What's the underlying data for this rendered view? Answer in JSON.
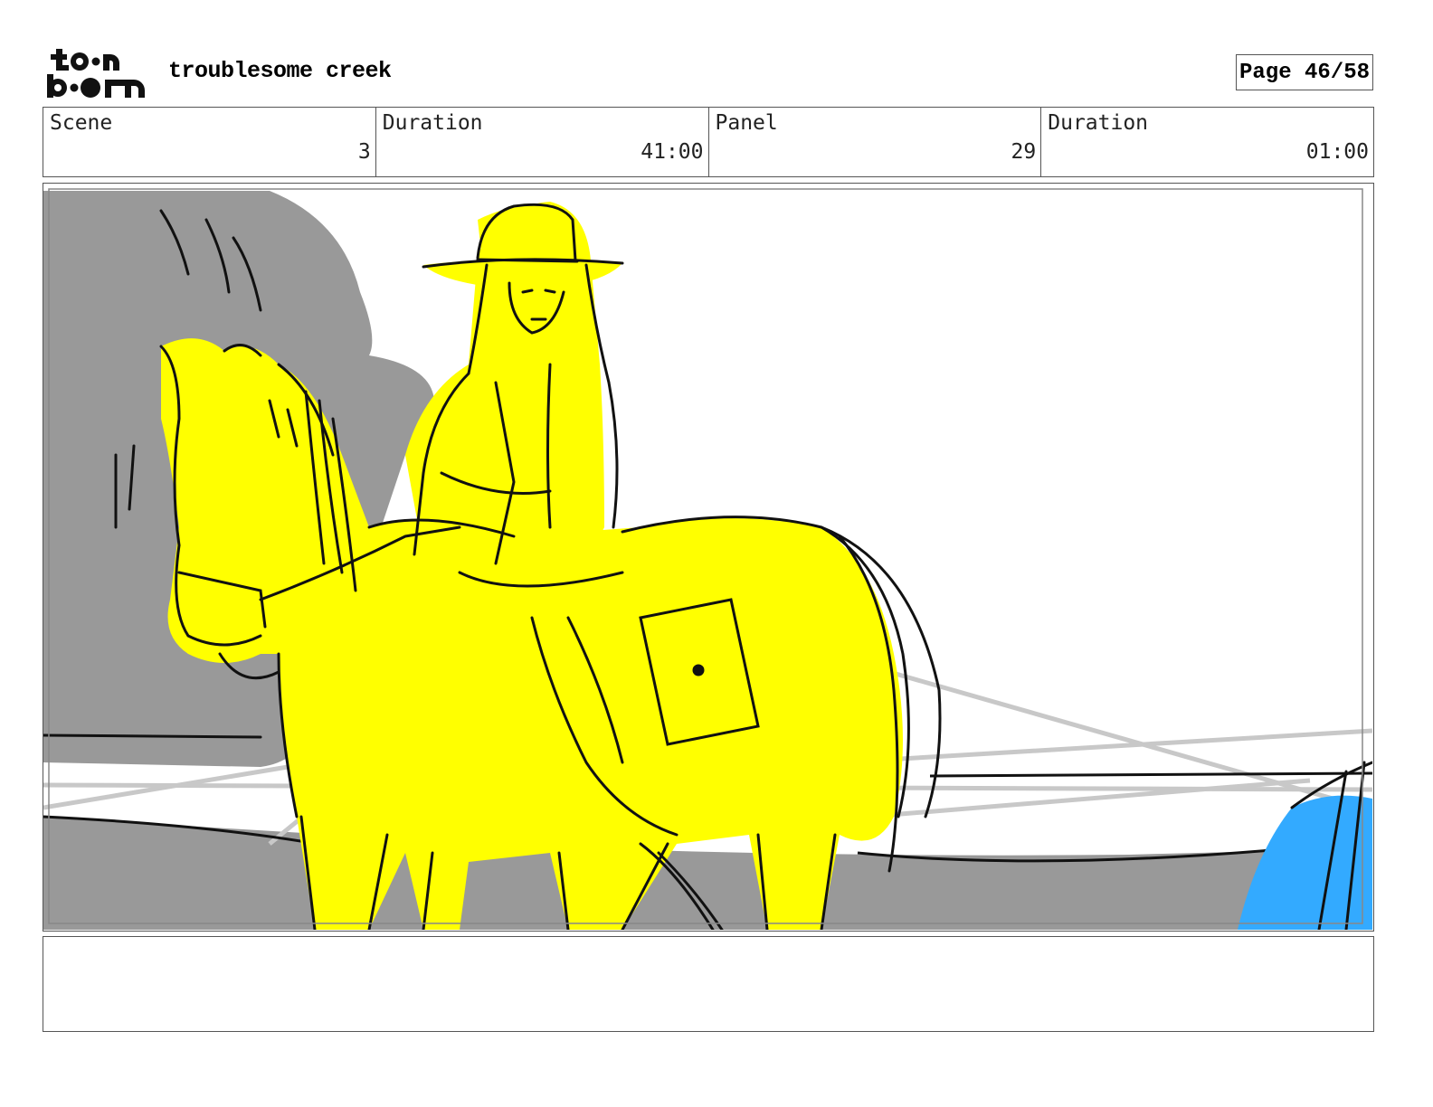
{
  "header": {
    "logo_text_top": "to•n",
    "logo_text_bottom": "b••m",
    "project_title": "troublesome creek",
    "page_indicator": "Page 46/58"
  },
  "info": {
    "scene_label": "Scene",
    "scene_value": "3",
    "scene_duration_label": "Duration",
    "scene_duration_value": "41:00",
    "panel_label": "Panel",
    "panel_value": "29",
    "panel_duration_label": "Duration",
    "panel_duration_value": "01:00"
  },
  "panel": {
    "colors": {
      "rider_and_horse": "#ffff00",
      "background_figure": "#999999",
      "ground": "#999999",
      "right_figure": "#33aaff",
      "line": "#111111",
      "guide_line": "#c8c8c8"
    }
  },
  "notes": {
    "text": ""
  }
}
